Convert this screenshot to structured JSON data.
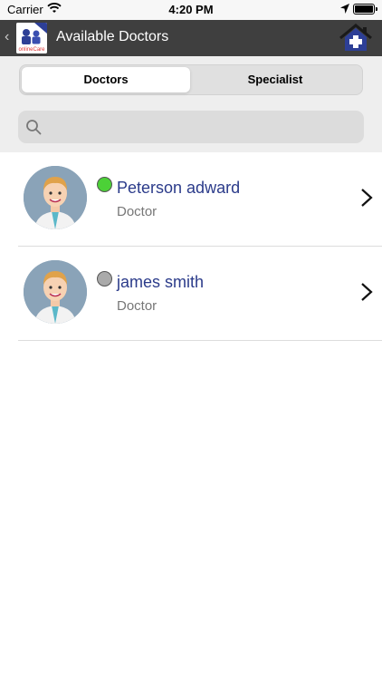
{
  "status_bar": {
    "carrier": "Carrier",
    "time": "4:20 PM"
  },
  "nav": {
    "back": "‹",
    "title": "Available Doctors",
    "logo_text": "onlineCare"
  },
  "segments": {
    "doctors": "Doctors",
    "specialist": "Specialist"
  },
  "search": {
    "placeholder": ""
  },
  "doctors": [
    {
      "name": "Peterson adward",
      "role": "Doctor",
      "status": "online",
      "status_color": "#4cd137"
    },
    {
      "name": "james smith",
      "role": "Doctor",
      "status": "offline",
      "status_color": "#aaaaaa"
    }
  ],
  "colors": {
    "nav": "#3f3f3f",
    "name": "#2b3b8a",
    "home_icon": "#2d3f96"
  }
}
